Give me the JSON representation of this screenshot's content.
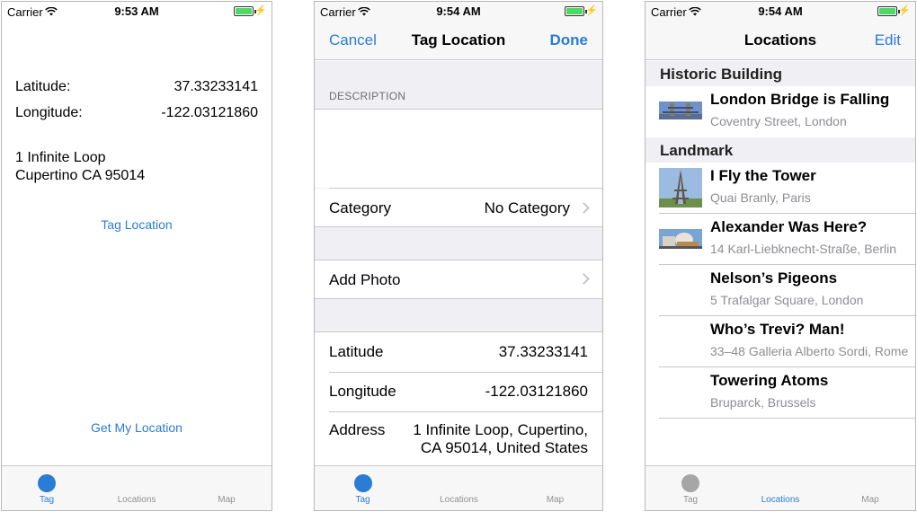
{
  "status_bar": {
    "carrier": "Carrier",
    "times": [
      "9:53 AM",
      "9:54 AM",
      "9:54 AM"
    ]
  },
  "tabs": [
    "Tag",
    "Locations",
    "Map"
  ],
  "colors": {
    "tint": "#2a7cd4",
    "inactive": "#929292",
    "separator": "#c8c7cc",
    "group_bg": "#efeff4",
    "battery": "#4cd964"
  },
  "screen1": {
    "latitude_label": "Latitude:",
    "latitude_value": "37.33233141",
    "longitude_label": "Longitude:",
    "longitude_value": "-122.03121860",
    "address_line1": "1 Infinite Loop",
    "address_line2": "Cupertino CA 95014",
    "tag_button": "Tag Location",
    "get_location_button": "Get My Location",
    "active_tab": "Tag"
  },
  "screen2": {
    "cancel": "Cancel",
    "title": "Tag Location",
    "done": "Done",
    "description_header": "DESCRIPTION",
    "category_label": "Category",
    "category_value": "No Category",
    "add_photo_label": "Add Photo",
    "latitude_label": "Latitude",
    "latitude_value": "37.33233141",
    "longitude_label": "Longitude",
    "longitude_value": "-122.03121860",
    "address_label": "Address",
    "address_line1": "1 Infinite Loop, Cupertino,",
    "address_line2": "CA 95014, United States",
    "active_tab": "Tag"
  },
  "screen3": {
    "title": "Locations",
    "edit": "Edit",
    "active_tab": "Locations",
    "sections": [
      {
        "name": "Historic Building",
        "items": [
          {
            "title": "London Bridge is Falling",
            "subtitle": "Coventry Street, London",
            "thumbnail": "tower-bridge-photo"
          }
        ]
      },
      {
        "name": "Landmark",
        "items": [
          {
            "title": "I Fly the Tower",
            "subtitle": "Quai Branly, Paris",
            "thumbnail": "eiffel-tower-photo"
          },
          {
            "title": "Alexander Was Here?",
            "subtitle": "14 Karl-Liebknecht-Straße, Berlin",
            "thumbnail": "berlin-building-photo"
          },
          {
            "title": "Nelson’s Pigeons",
            "subtitle": "5 Trafalgar Square, London",
            "thumbnail": ""
          },
          {
            "title": "Who’s Trevi? Man!",
            "subtitle": "33–48 Galleria Alberto Sordi, Rome",
            "thumbnail": ""
          },
          {
            "title": "Towering Atoms",
            "subtitle": "Bruparck, Brussels",
            "thumbnail": ""
          }
        ]
      }
    ]
  }
}
